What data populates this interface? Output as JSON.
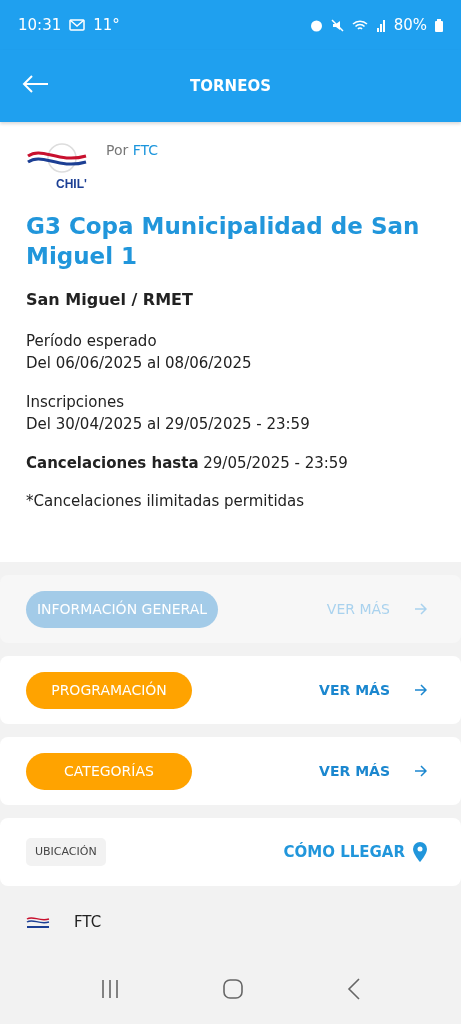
{
  "status_bar": {
    "time": "10:31",
    "temperature": "11°",
    "battery": "80%"
  },
  "app_bar": {
    "title": "TORNEOS"
  },
  "tournament": {
    "organizer_prefix": "Por",
    "organizer": "FTC",
    "logo_text": "CHIL'",
    "title": "G3 Copa Municipalidad de San Miguel 1",
    "location": "San Miguel / RMET",
    "period_label": "Período esperado",
    "period": "Del 06/06/2025 al 08/06/2025",
    "registration_label": "Inscripciones",
    "registration": "Del 30/04/2025 al 29/05/2025 - 23:59",
    "cancel_label": "Cancelaciones hasta",
    "cancel": "29/05/2025 - 23:59",
    "note": "*Cancelaciones ilimitadas permitidas"
  },
  "sections": [
    {
      "label": "INFORMACIÓN GENERAL",
      "link": "VER MÁS",
      "disabled": true
    },
    {
      "label": "PROGRAMACIÓN",
      "link": "VER MÁS",
      "disabled": false
    },
    {
      "label": "CATEGORÍAS",
      "link": "VER MÁS",
      "disabled": false
    }
  ],
  "location_card": {
    "tag": "UBICACIÓN",
    "link": "CÓMO LLEGAR"
  },
  "footer": {
    "organizer": "FTC"
  }
}
